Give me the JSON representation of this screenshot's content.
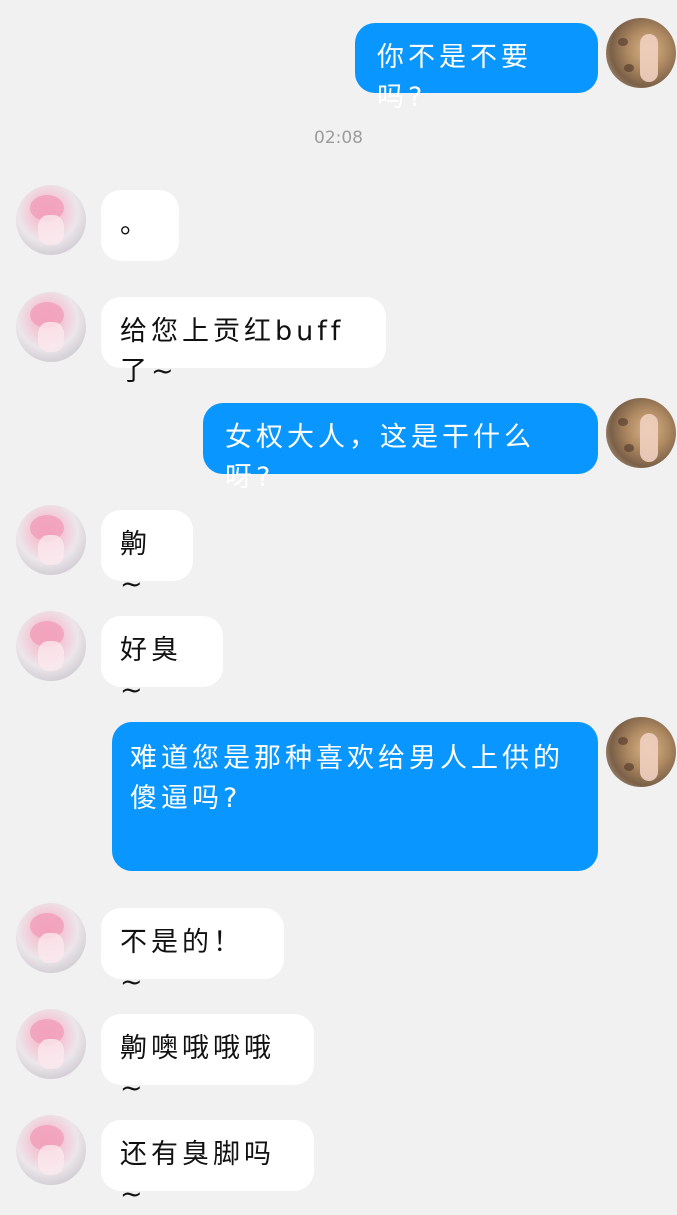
{
  "chat": {
    "timestamp": "02:08",
    "messages": [
      {
        "side": "out",
        "text": "你不是不要吗?"
      },
      {
        "side": "in",
        "text": "。"
      },
      {
        "side": "in",
        "text": "给您上贡红buff了~"
      },
      {
        "side": "out",
        "text": "女权大人，这是干什么呀?"
      },
      {
        "side": "in",
        "text": "齁~"
      },
      {
        "side": "in",
        "text": "好臭~"
      },
      {
        "side": "out",
        "text": "难道您是那种喜欢给男人上供的傻逼吗?"
      },
      {
        "side": "in",
        "text": "不是的！~"
      },
      {
        "side": "in",
        "text": "齁噢哦哦哦~"
      },
      {
        "side": "in",
        "text": "还有臭脚吗~"
      }
    ]
  },
  "avatars": {
    "self": "cat-paw-photo-avatar",
    "other": "pink-anime-girl-avatar"
  },
  "colors": {
    "background": "#f1f1f1",
    "outgoing_bubble": "#0996ff",
    "incoming_bubble": "#ffffff",
    "timestamp_text": "#9c9c9c"
  }
}
